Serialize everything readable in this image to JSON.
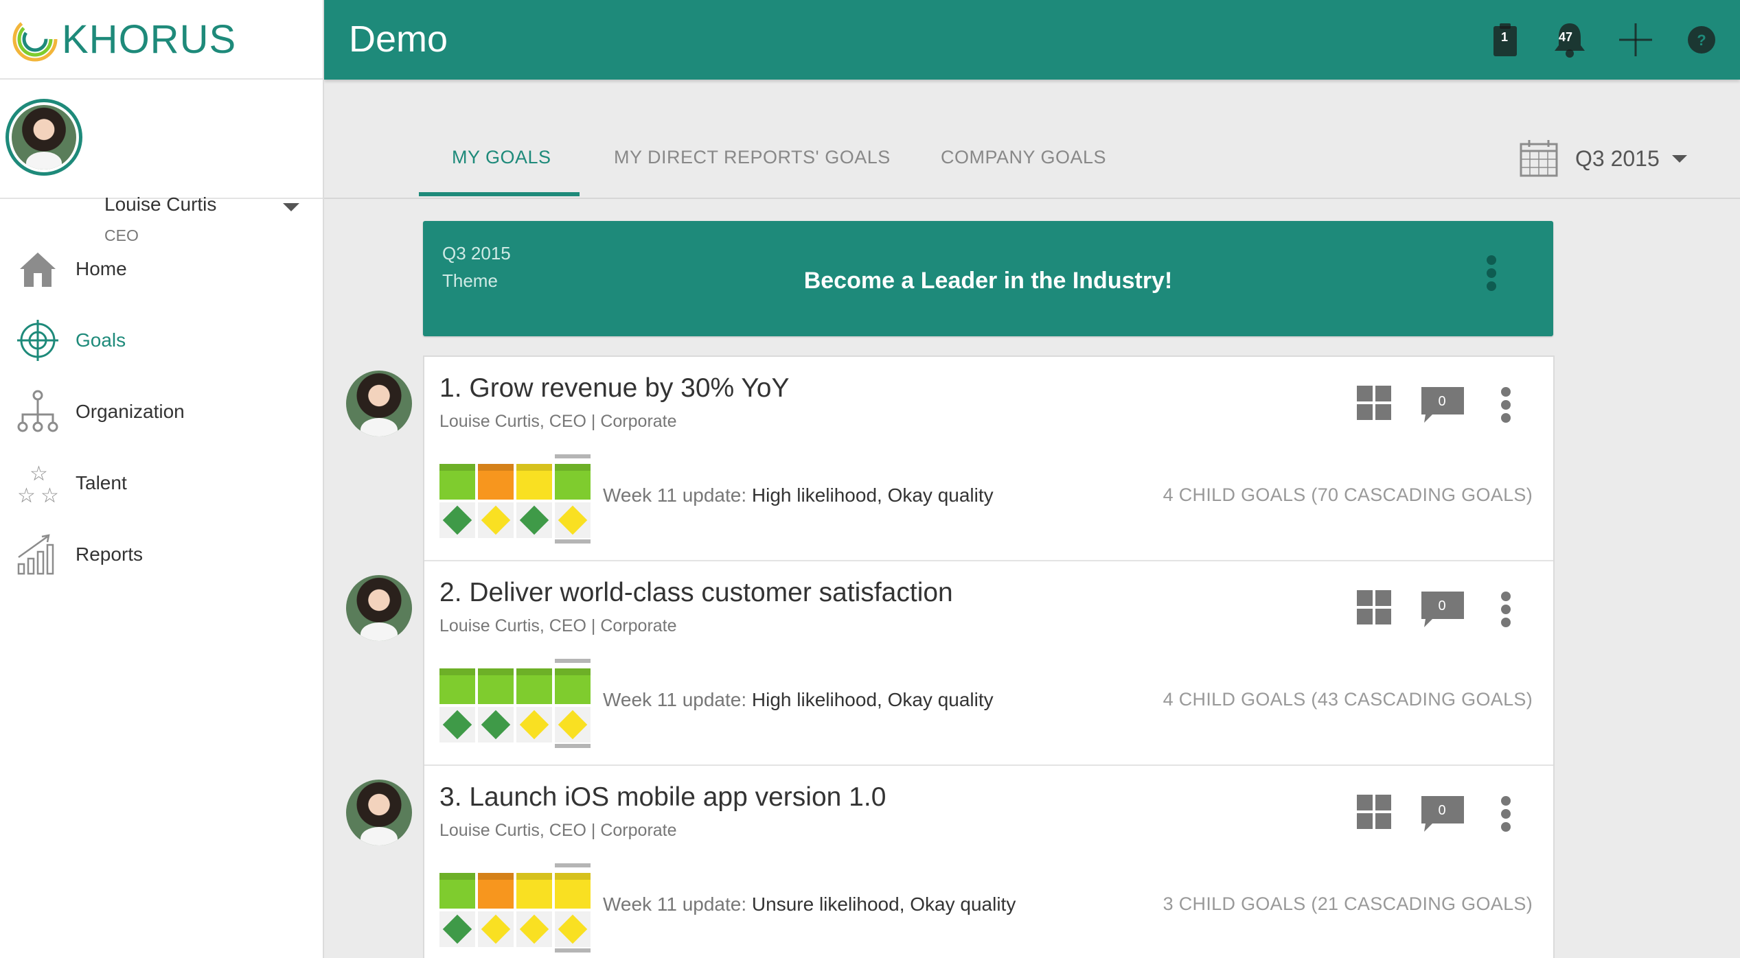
{
  "app": {
    "logo_text": "KHORUS",
    "page_title": "Demo"
  },
  "header": {
    "clipboard_count": "1",
    "notification_count": "47",
    "add_label": "+",
    "help_label": "?"
  },
  "user": {
    "name": "Louise Curtis",
    "role": "CEO"
  },
  "nav": [
    {
      "label": "Home",
      "icon": "home-icon",
      "active": false
    },
    {
      "label": "Goals",
      "icon": "target-icon",
      "active": true
    },
    {
      "label": "Organization",
      "icon": "org-chart-icon",
      "active": false
    },
    {
      "label": "Talent",
      "icon": "stars-icon",
      "active": false
    },
    {
      "label": "Reports",
      "icon": "bar-chart-icon",
      "active": false
    }
  ],
  "tabs": [
    {
      "label": "MY GOALS",
      "active": true
    },
    {
      "label": "MY DIRECT REPORTS' GOALS",
      "active": false
    },
    {
      "label": "COMPANY GOALS",
      "active": false
    }
  ],
  "period": {
    "label": "Q3 2015",
    "icon": "calendar-icon"
  },
  "theme": {
    "period": "Q3 2015",
    "label": "Theme",
    "text": "Become a Leader in the Industry!"
  },
  "colors": {
    "brand": "#1e8a7a",
    "green": "#7fcc2e",
    "orange": "#f7961e",
    "yellow": "#f9e022",
    "dark_green": "#3f9a48"
  },
  "goals": [
    {
      "title": "1. Grow revenue by 30% YoY",
      "meta": "Louise Curtis, CEO | Corporate",
      "comments": "0",
      "update_prefix": "Week 11 update:",
      "update_value": "High likelihood, Okay quality",
      "children": "4 CHILD GOALS (70 CASCADING GOALS)",
      "likelihood": [
        "green",
        "orange",
        "yellow",
        "green"
      ],
      "quality": [
        "dark_green",
        "yellow",
        "dark_green",
        "yellow"
      ]
    },
    {
      "title": "2. Deliver world-class customer satisfaction",
      "meta": "Louise Curtis, CEO | Corporate",
      "comments": "0",
      "update_prefix": "Week 11 update:",
      "update_value": "High likelihood, Okay quality",
      "children": "4 CHILD GOALS (43 CASCADING GOALS)",
      "likelihood": [
        "green",
        "green",
        "green",
        "green"
      ],
      "quality": [
        "dark_green",
        "dark_green",
        "yellow",
        "yellow"
      ]
    },
    {
      "title": "3. Launch iOS mobile app version 1.0",
      "meta": "Louise Curtis, CEO | Corporate",
      "comments": "0",
      "update_prefix": "Week 11 update:",
      "update_value": "Unsure likelihood, Okay quality",
      "children": "3 CHILD GOALS (21 CASCADING GOALS)",
      "likelihood": [
        "green",
        "orange",
        "yellow",
        "yellow"
      ],
      "quality": [
        "dark_green",
        "yellow",
        "yellow",
        "yellow"
      ]
    }
  ]
}
